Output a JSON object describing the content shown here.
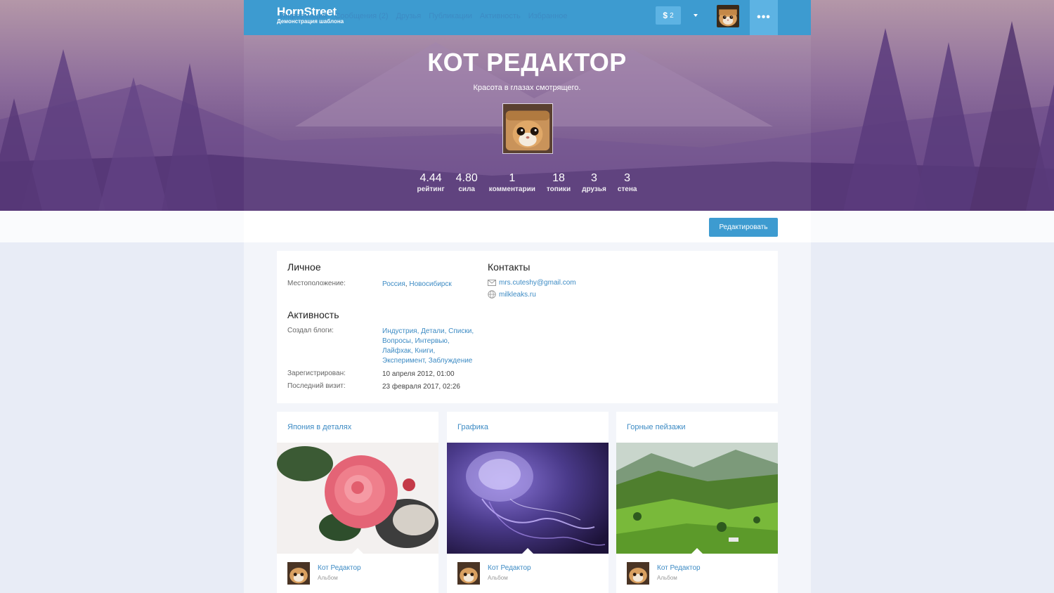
{
  "header": {
    "logo_title": "HornStreet",
    "logo_subtitle": "Демонстрация шаблона",
    "money_symbol": "$",
    "money_count": "2",
    "more_label": "•••"
  },
  "profile": {
    "name": "КОТ РЕДАКТОР",
    "status": "Красота в глазах смотрящего.",
    "stats": [
      {
        "value": "4.44",
        "label": "рейтинг"
      },
      {
        "value": "4.80",
        "label": "сила"
      },
      {
        "value": "1",
        "label": "комментарии"
      },
      {
        "value": "18",
        "label": "топики"
      },
      {
        "value": "3",
        "label": "друзья"
      },
      {
        "value": "3",
        "label": "стена"
      }
    ]
  },
  "tabs": [
    {
      "label": "Информация",
      "active": true
    },
    {
      "label": "Сообщения (2)"
    },
    {
      "label": "Друзья"
    },
    {
      "label": "Публикации"
    },
    {
      "label": "Активность"
    },
    {
      "label": "Избранное"
    }
  ],
  "edit_button": "Редактировать",
  "info": {
    "personal_title": "Личное",
    "location_label": "Местоположение:",
    "location_country": "Россия",
    "location_city": "Новосибирск",
    "contacts_title": "Контакты",
    "email": "mrs.cuteshy@gmail.com",
    "website": "milkleaks.ru",
    "activity_title": "Активность",
    "blogs_label": "Создал блоги:",
    "blogs_line1": "Индустрия, Детали, Списки,",
    "blogs_line2": "Вопросы, Интервью,",
    "blogs_line3": "Лайфхак, Книги,",
    "blogs_line4": "Эксперимент, Заблуждение",
    "registered_label": "Зарегистрирован:",
    "registered_value": "10 апреля 2012, 01:00",
    "last_visit_label": "Последний визит:",
    "last_visit_value": "23 февраля 2017, 02:26"
  },
  "albums": [
    {
      "title": "Япония в деталях",
      "author": "Кот Редактор",
      "type": "Альбом"
    },
    {
      "title": "Графика",
      "author": "Кот Редактор",
      "type": "Альбом"
    },
    {
      "title": "Горные пейзажи",
      "author": "Кот Редактор",
      "type": "Альбом"
    }
  ],
  "colors": {
    "accent": "#3d9bd0",
    "link": "#3d8bc4",
    "hero_bottom": "#5a3a7c"
  }
}
